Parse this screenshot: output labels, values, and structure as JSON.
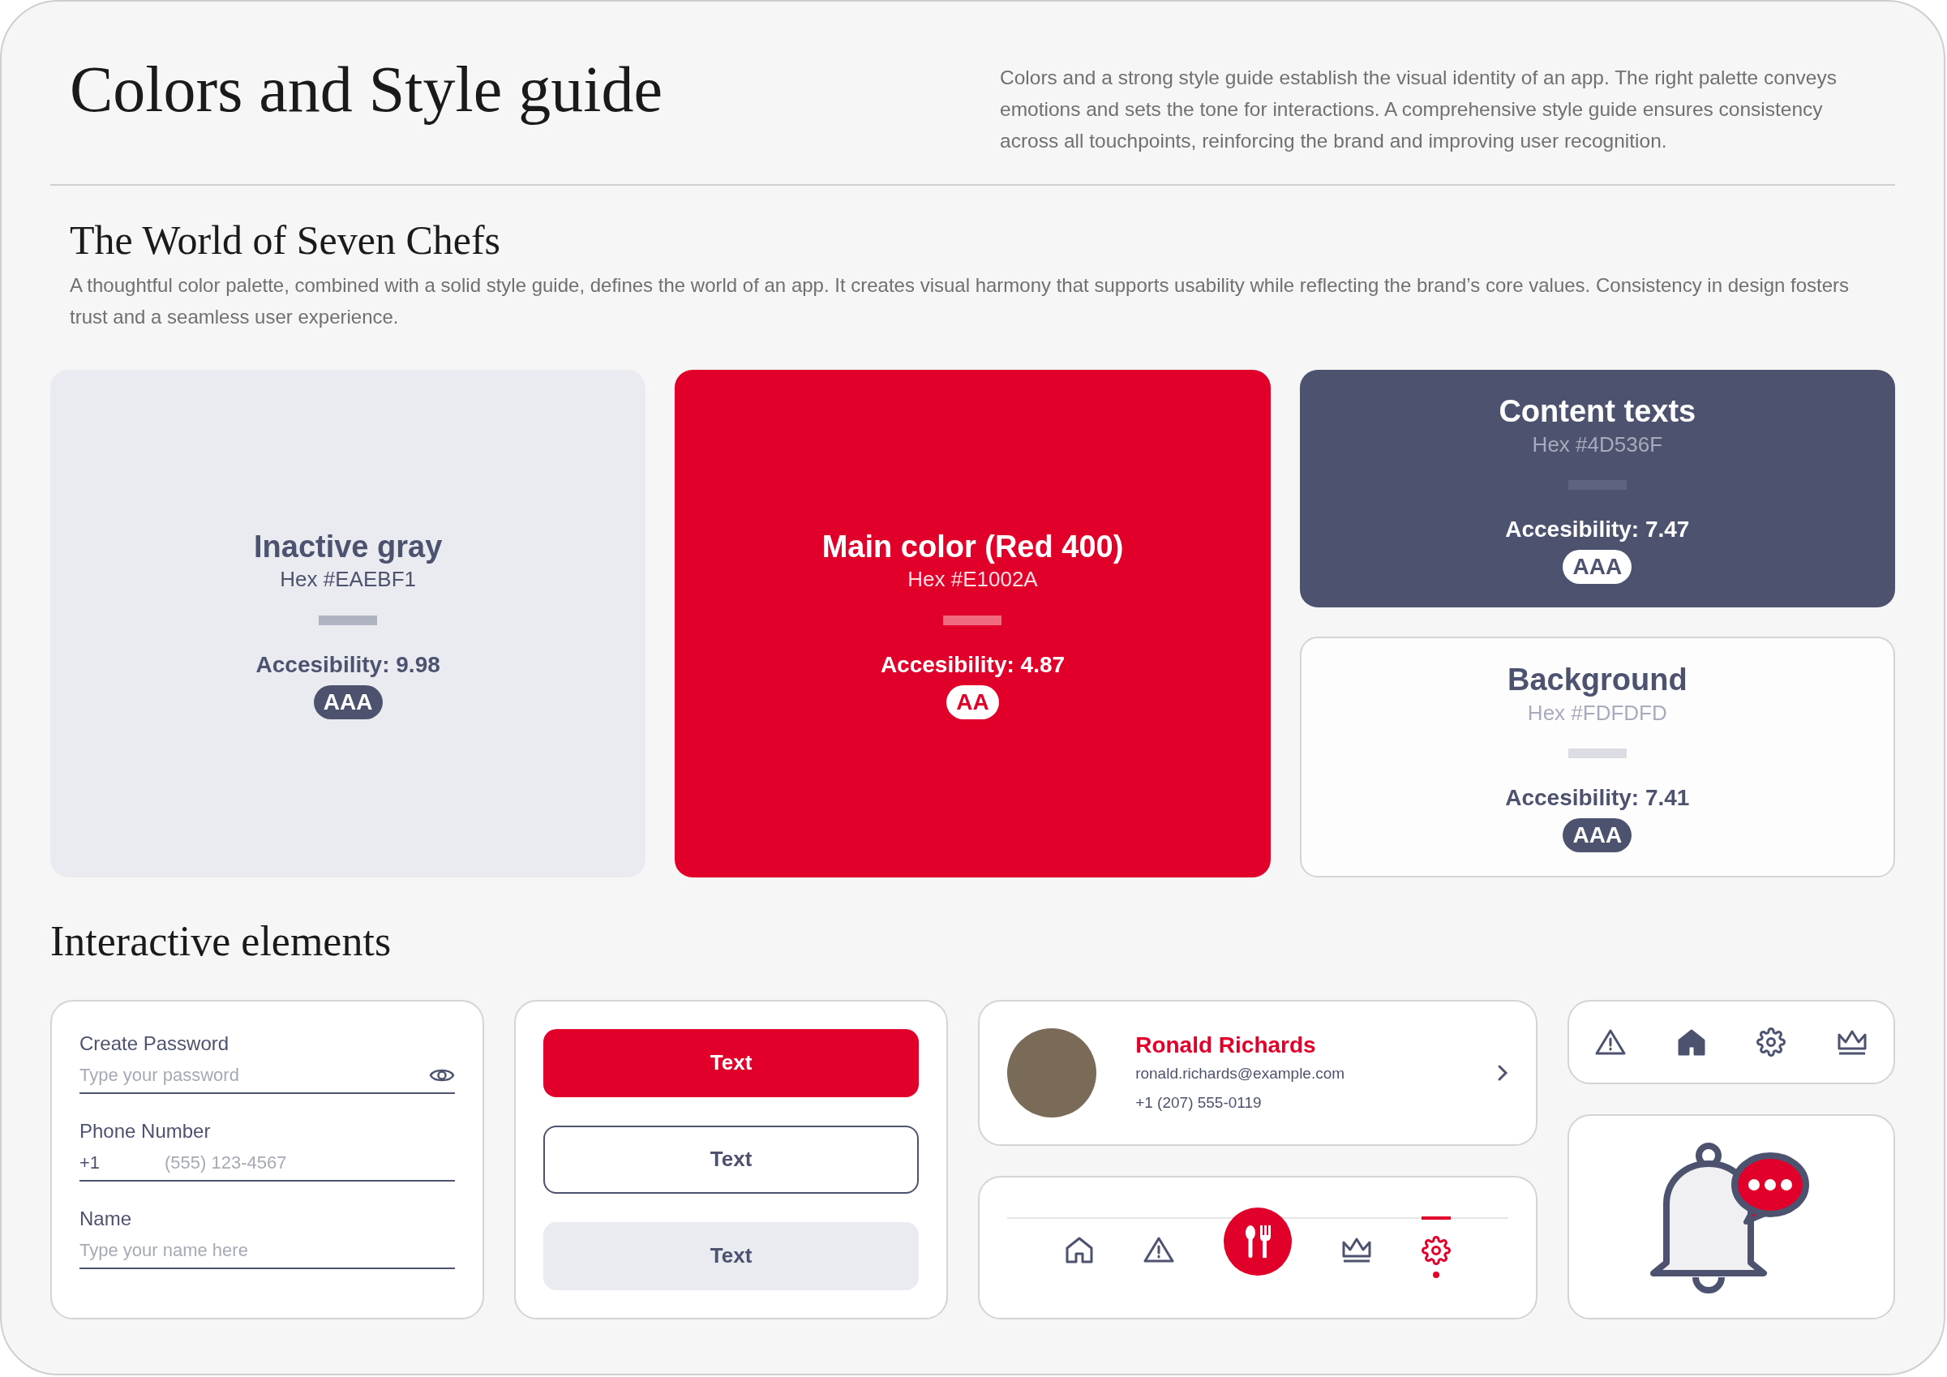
{
  "header": {
    "title": "Colors and Style guide",
    "description": "Colors and a strong style guide establish the visual identity of an app. The right palette conveys emotions and sets the tone for interactions. A comprehensive style guide ensures consistency across all touchpoints, reinforcing the brand and improving user recognition."
  },
  "intro": {
    "title": "The World of Seven Chefs",
    "description": "A thoughtful color palette, combined with a solid style guide, defines the world of an app. It creates visual harmony that supports usability while reflecting the brand’s core values. Consistency in design fosters trust and a seamless user experience."
  },
  "color_cards": [
    {
      "kind": "light",
      "color": "#eaebf1",
      "name": "Inactive gray",
      "hex": "Hex #EAEBF1",
      "accessibility": "Accesibility: 9.98",
      "rating": "AAA"
    },
    {
      "kind": "primary",
      "color": "#e1002a",
      "name": "Main color (Red 400)",
      "hex": "Hex #E1002A",
      "accessibility": "Accesibility: 4.87",
      "rating": "AA"
    },
    {
      "kind": "dark",
      "color": "#4d536f",
      "name": "Content texts",
      "hex": "Hex #4D536F",
      "accessibility": "Accesibility: 7.47",
      "rating": "AAA"
    },
    {
      "kind": "outline",
      "color": "#fdfdfd",
      "name": "Background",
      "hex": "Hex #FDFDFD",
      "accessibility": "Accesibility: 7.41",
      "rating": "AAA"
    }
  ],
  "interactive": {
    "title": "Interactive elements",
    "fields": [
      {
        "kind": "password",
        "label": "Create Password",
        "placeholder": "Type your password"
      },
      {
        "kind": "phone",
        "label": "Phone Number",
        "prefix": "+1",
        "placeholder": "(555) 123-4567"
      },
      {
        "kind": "text",
        "label": "Name",
        "placeholder": "Type your name here"
      }
    ],
    "buttons": [
      {
        "kind": "filled",
        "label": "Text"
      },
      {
        "kind": "outline",
        "label": "Text"
      },
      {
        "kind": "muted",
        "label": "Text"
      }
    ],
    "profile": {
      "name": "Ronald Richards",
      "email": "ronald.richards@example.com",
      "phone": "+1 (207) 555-0119"
    },
    "bottom_nav": [
      {
        "selected": false
      },
      {
        "selected": false
      },
      {
        "selected": false
      },
      {
        "selected": false
      },
      {
        "selected": true
      }
    ],
    "icon_bar": [
      {
        "selected": false
      },
      {
        "selected": true
      },
      {
        "selected": false
      },
      {
        "selected": false
      }
    ]
  }
}
